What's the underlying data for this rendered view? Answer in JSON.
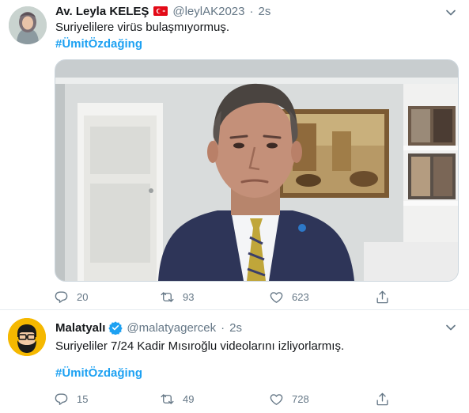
{
  "tweets": [
    {
      "author_name": "Av. Leyla KELEŞ",
      "handle": "@leylAK2023",
      "separator": "·",
      "time": "2s",
      "text": "Suriyelilere virüs bulaşmıyormuş.",
      "hashtag": "#ÜmitÖzdağing",
      "replies": "20",
      "retweets": "93",
      "likes": "623"
    },
    {
      "author_name": "Malatyalı",
      "handle": "@malatyagercek",
      "separator": "·",
      "time": "2s",
      "text": "Suriyeliler 7/24 Kadir Mısıroğlu videolarını izliyorlarmış.",
      "hashtag": "#ÜmitÖzdağing",
      "replies": "15",
      "retweets": "49",
      "likes": "728"
    }
  ],
  "icons": {
    "reply": "reply-icon",
    "retweet": "retweet-icon",
    "like": "heart-icon",
    "share": "share-icon",
    "more": "chevron-down-icon",
    "verified": "verified-badge-icon",
    "flag": "turkish-flag-icon"
  },
  "colors": {
    "link": "#1da1f2",
    "muted": "#657786",
    "text": "#14171a",
    "verified": "#1da1f2",
    "flag": "#e30a17"
  }
}
